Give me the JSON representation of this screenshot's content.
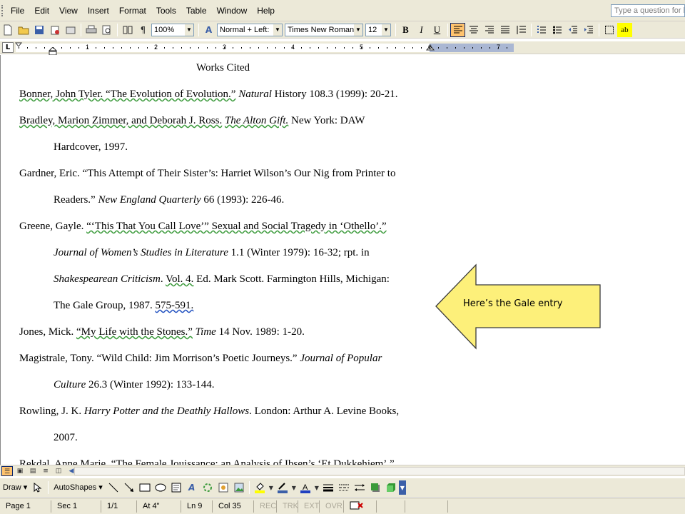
{
  "menubar": {
    "items": [
      "File",
      "Edit",
      "View",
      "Insert",
      "Format",
      "Tools",
      "Table",
      "Window",
      "Help"
    ],
    "help_placeholder": "Type a question for h"
  },
  "toolbar": {
    "zoom": "100%",
    "style": "Normal + Left:",
    "font": "Times New Roman",
    "size": "12",
    "bold": "B",
    "italic": "I",
    "underline": "U"
  },
  "ruler": {
    "numbers": [
      "1",
      "2",
      "3",
      "4",
      "5",
      "6",
      "7"
    ]
  },
  "document": {
    "title": "Works Cited",
    "lines": [
      {
        "segments": [
          {
            "t": "Bonner, John Tyler. “The Evolution of Evolution.”",
            "s": "wv"
          },
          {
            "t": " "
          },
          {
            "t": "Natural",
            "s": "i"
          },
          {
            "t": " History 108.3 (1999): 20-21."
          }
        ],
        "indent": false
      },
      {
        "segments": [
          {
            "t": "Bradley, Marion Zimmer, and Deborah J. Ross.",
            "s": "wv"
          },
          {
            "t": " "
          },
          {
            "t": "The Alton Gift.",
            "s": "iwv"
          },
          {
            "t": " New York: DAW"
          }
        ],
        "indent": false
      },
      {
        "segments": [
          {
            "t": "Hardcover, 1997."
          }
        ],
        "indent": true
      },
      {
        "segments": [
          {
            "t": "Gardner, Eric. “This Attempt of Their Sister’s: Harriet Wilson’s Our Nig from Printer to"
          }
        ],
        "indent": false
      },
      {
        "segments": [
          {
            "t": "Readers.” "
          },
          {
            "t": "New England Quarterly",
            "s": "i"
          },
          {
            "t": " 66 (1993): 226-46."
          }
        ],
        "indent": true
      },
      {
        "segments": [
          {
            "t": "Greene, Gayle. "
          },
          {
            "t": "“‘This That You Call Love’” Sexual and Social Tragedy in ‘Othello’.”",
            "s": "wv"
          }
        ],
        "indent": false
      },
      {
        "segments": [
          {
            "t": "Journal of Women’s Studies in Literature",
            "s": "i"
          },
          {
            "t": " 1.1 (Winter 1979): 16-32; rpt. in"
          }
        ],
        "indent": true
      },
      {
        "segments": [
          {
            "t": "Shakespearean Criticism",
            "s": "i"
          },
          {
            "t": ".  "
          },
          {
            "t": "Vol. 4.",
            "s": "wv"
          },
          {
            "t": " Ed. Mark Scott. Farmington Hills, Michigan:"
          }
        ],
        "indent": true
      },
      {
        "segments": [
          {
            "t": "The Gale Group, 1987. "
          },
          {
            "t": "575-591.",
            "s": "wvb"
          }
        ],
        "indent": true
      },
      {
        "segments": [
          {
            "t": "Jones, Mick. "
          },
          {
            "t": "“My Life with the Stones.”",
            "s": "wv"
          },
          {
            "t": " "
          },
          {
            "t": "Time",
            "s": "i"
          },
          {
            "t": " 14 Nov. 1989: 1-20."
          }
        ],
        "indent": false
      },
      {
        "segments": [
          {
            "t": "Magistrale, Tony. “Wild Child: Jim Morrison’s Poetic Journeys.” "
          },
          {
            "t": "Journal of Popular",
            "s": "i"
          }
        ],
        "indent": false
      },
      {
        "segments": [
          {
            "t": "Culture",
            "s": "i"
          },
          {
            "t": " 26.3 (Winter 1992): 133-144."
          }
        ],
        "indent": true
      },
      {
        "segments": [
          {
            "t": "Rowling, J. K. "
          },
          {
            "t": "Harry Potter and the Deathly Hallows",
            "s": "i"
          },
          {
            "t": ". London: Arthur A. Levine Books,"
          }
        ],
        "indent": false
      },
      {
        "segments": [
          {
            "t": "2007."
          }
        ],
        "indent": true
      },
      {
        "segments": [
          {
            "t": "Rekdal, Anne Marie. “The Female Jouissance: an Analysis of Ibsen’s ‘Et Dukkehjem’.”"
          }
        ],
        "indent": false
      }
    ]
  },
  "callout": {
    "text": "Here’s the Gale entry",
    "fill": "#fdf07a",
    "stroke": "#3a3a3a"
  },
  "drawbar": {
    "draw": "Draw",
    "autoshapes": "AutoShapes"
  },
  "status": {
    "page": "Page 1",
    "sec": "Sec 1",
    "pages": "1/1",
    "at": "At 4\"",
    "ln": "Ln 9",
    "col": "Col 35",
    "rec": "REC",
    "trk": "TRK",
    "ext": "EXT",
    "ovr": "OVR"
  }
}
